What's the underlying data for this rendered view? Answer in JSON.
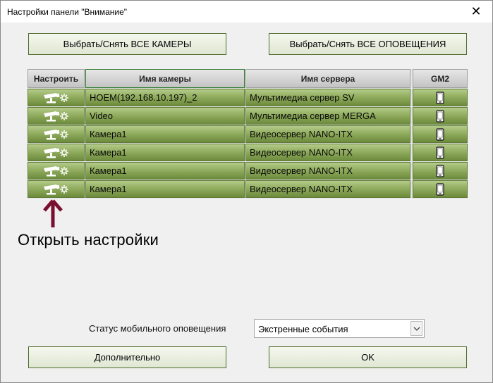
{
  "window": {
    "title": "Настройки панели \"Внимание\"",
    "close_glyph": "✕"
  },
  "top_buttons": {
    "select_all_cameras": "Выбрать/Снять ВСЕ КАМЕРЫ",
    "select_all_alerts": "Выбрать/Снять ВСЕ ОПОВЕЩЕНИЯ"
  },
  "table": {
    "columns": {
      "settings": "Настроить",
      "camera": "Имя камеры",
      "server": "Имя сервера",
      "gm2": "GM2"
    },
    "rows": [
      {
        "camera": "HOEM(192.168.10.197)_2",
        "server": "Мультимедиа сервер SV"
      },
      {
        "camera": "Video",
        "server": "Мультимедиа сервер MERGA"
      },
      {
        "camera": "Камера1",
        "server": "Видеосервер NANO-ITX"
      },
      {
        "camera": "Камера1",
        "server": "Видеосервер NANO-ITX"
      },
      {
        "camera": "Камера1",
        "server": "Видеосервер NANO-ITX"
      },
      {
        "camera": "Камера1",
        "server": "Видеосервер NANO-ITX"
      }
    ],
    "settings_icon": "camera-settings-icon",
    "gm2_icon": "mobile-phone-icon",
    "row_color": "#8aa85a"
  },
  "annotation": {
    "text": "Открыть настройки",
    "arrow_color": "#7a1030"
  },
  "footer": {
    "status_label": "Статус мобильного оповещения",
    "status_value": "Экстренные события",
    "more_button": "Дополнительно",
    "ok_button": "OK"
  }
}
